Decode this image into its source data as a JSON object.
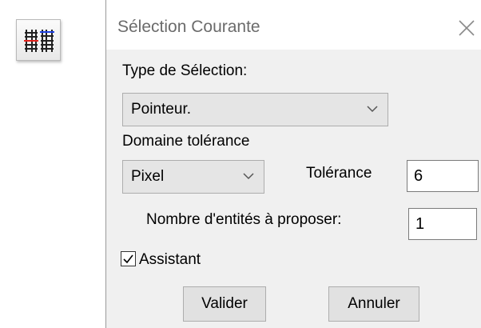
{
  "toolbar": {
    "tool_icon": "selection-mode-icon"
  },
  "dialog": {
    "title": "Sélection Courante",
    "close_icon": "close-icon",
    "selection_type": {
      "label": "Type de Sélection:",
      "value": "Pointeur."
    },
    "tolerance_domain": {
      "label": "Domaine tolérance",
      "value": "Pixel"
    },
    "tolerance": {
      "label": "Tolérance",
      "value": "6"
    },
    "entity_count": {
      "label": "Nombre d'entités à proposer:",
      "value": "1"
    },
    "assistant": {
      "label": "Assistant",
      "checked": true
    },
    "buttons": {
      "ok_label": "Valider",
      "cancel_label": "Annuler"
    }
  },
  "colors": {
    "dialog_background": "#f0f0f0",
    "title_text": "#6b6b6b",
    "icon_red": "#e0221c",
    "icon_blue": "#1c3fe0"
  }
}
